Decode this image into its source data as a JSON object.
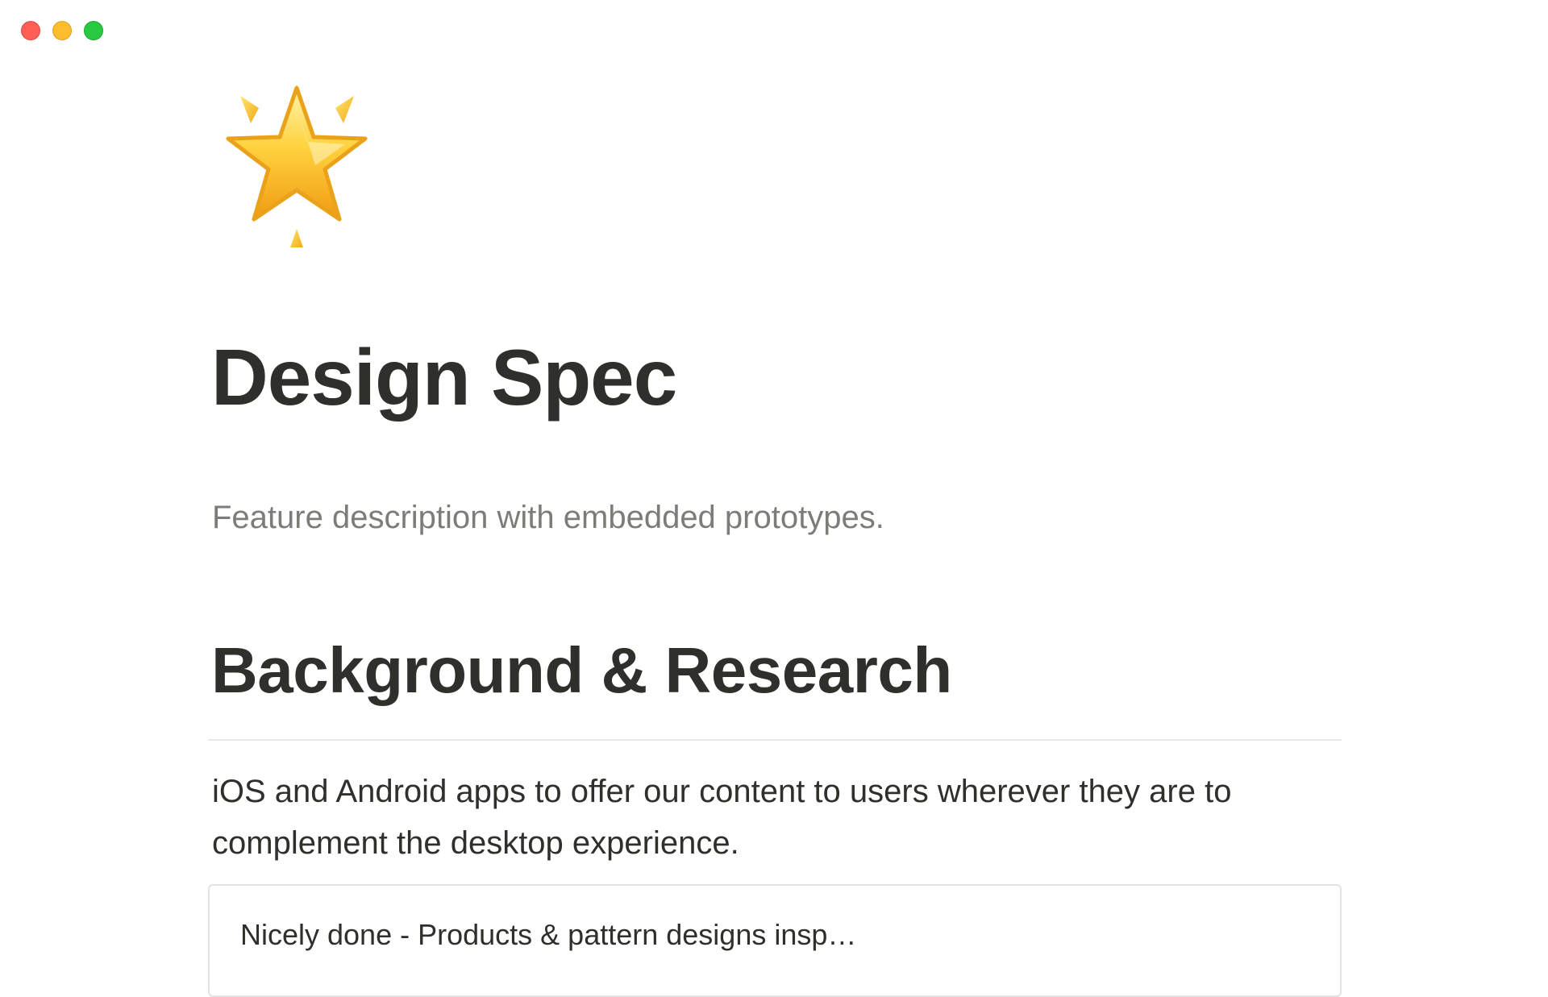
{
  "window": {
    "controls": [
      "close",
      "minimize",
      "zoom"
    ]
  },
  "page": {
    "icon": "glowing-star-icon",
    "title": "Design Spec",
    "description": "Feature description with embedded prototypes."
  },
  "section": {
    "heading": "Background & Research",
    "body": "iOS and Android apps to offer our content to users wherever they are to complement the desktop experience.",
    "bookmark": {
      "title": "Nicely done - Products & pattern designs insp…"
    }
  },
  "colors": {
    "close": "#ff5f57",
    "minimize": "#febc2e",
    "zoom": "#28c840",
    "text": "#2f2f2b",
    "muted_text": "#7d7c78",
    "divider": "#e9e9e7",
    "star": "#f7b52a"
  }
}
